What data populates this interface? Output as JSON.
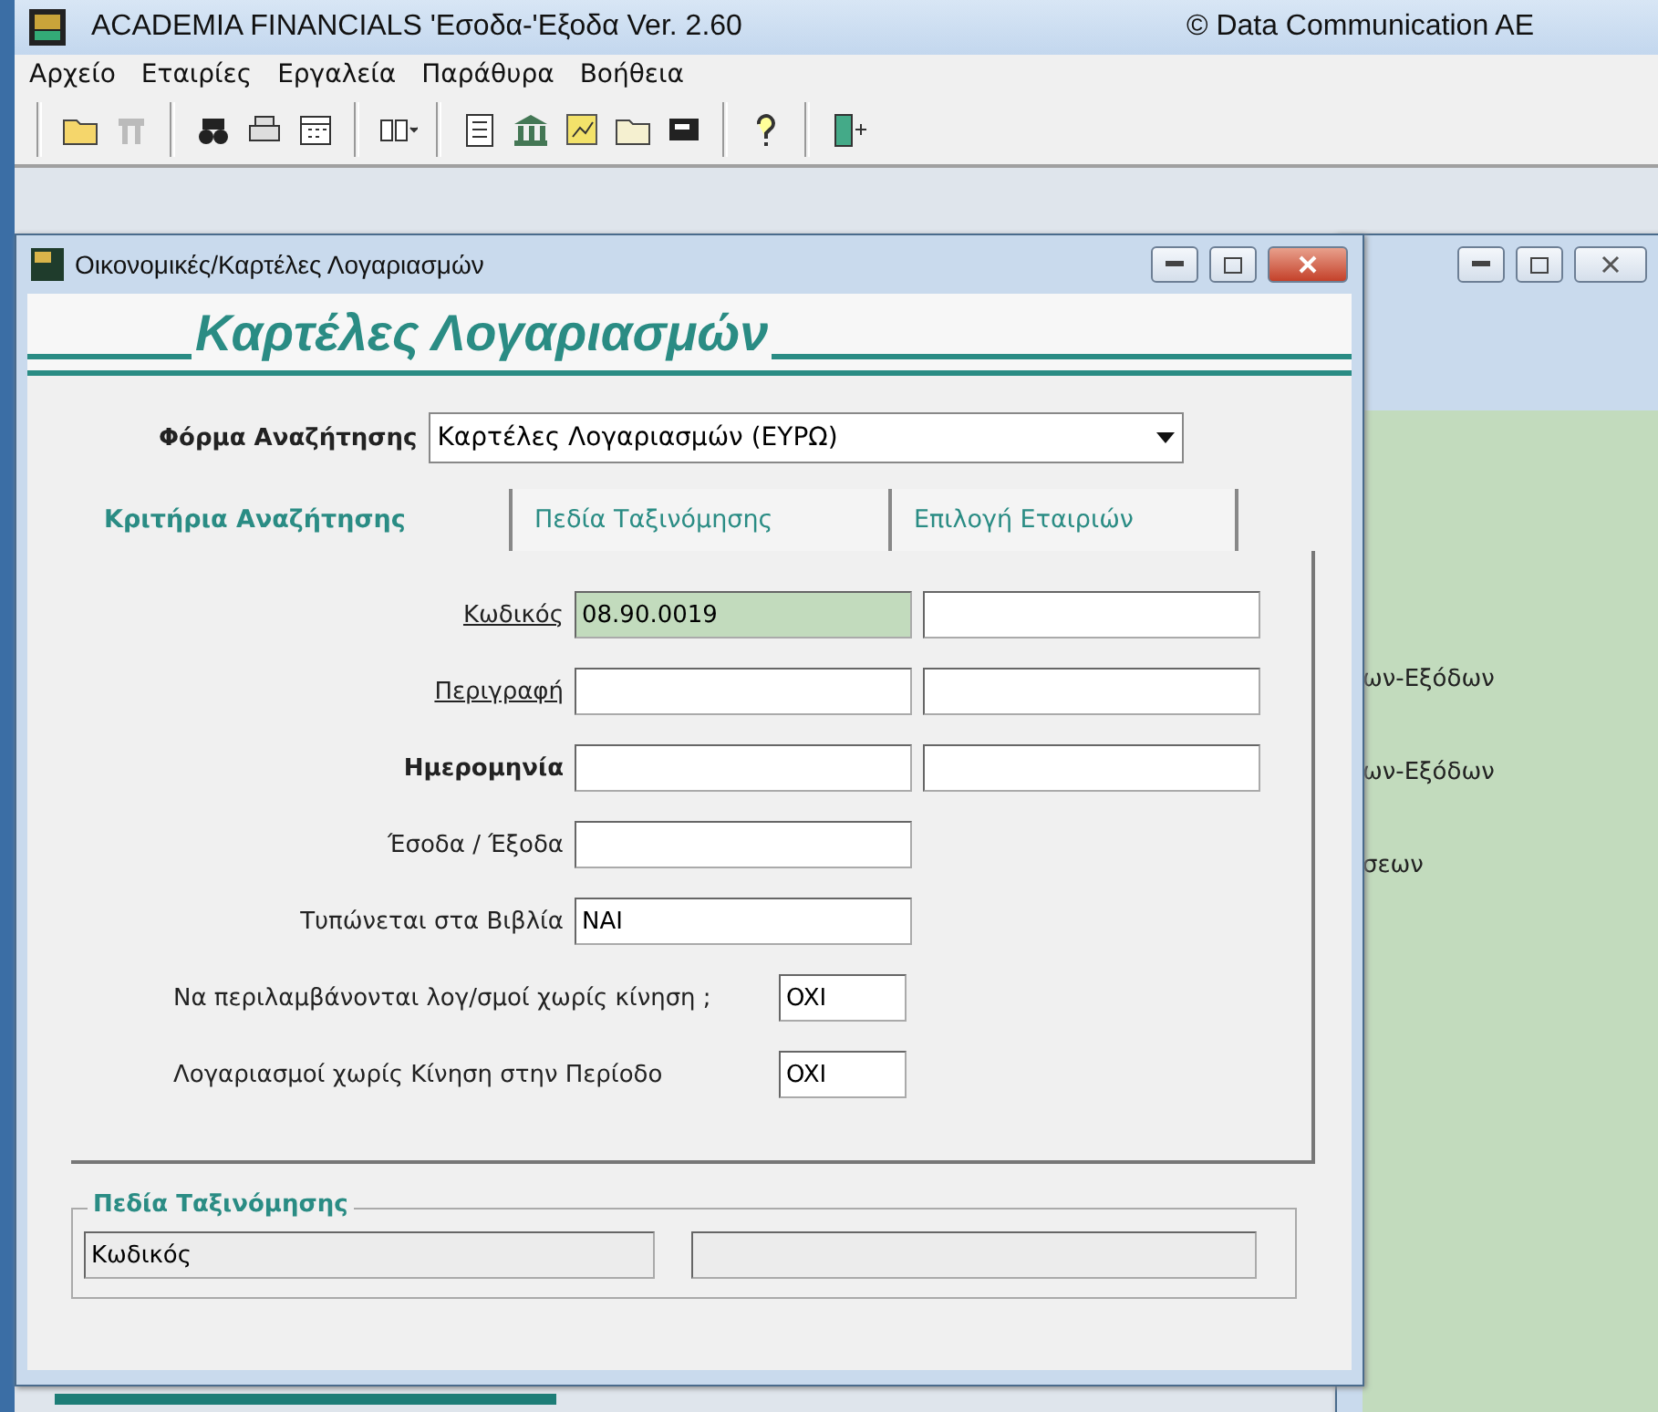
{
  "app": {
    "title": "ACADEMIA FINANCIALS 'Εσοδα-'Εξοδα Ver. 2.60",
    "copyright": "© Data Communication AE"
  },
  "menu": [
    "Αρχείο",
    "Εταιρίες",
    "Εργαλεία",
    "Παράθυρα",
    "Βοήθεια"
  ],
  "background_window": {
    "lines": [
      "ων-Εξόδων",
      "ων-Εξόδων",
      "σεων"
    ]
  },
  "dialog": {
    "title": "Οικονομικές/Καρτέλες Λογαριασμών",
    "heading": "Καρτέλες Λογαριασμών",
    "search_form": {
      "label": "Φόρμα Αναζήτησης",
      "value": "Καρτέλες Λογαριασμών (ΕΥΡΩ)"
    },
    "tabs": [
      {
        "label": "Κριτήρια Αναζήτησης",
        "selected": true
      },
      {
        "label": "Πεδία Ταξινόμησης",
        "selected": false
      },
      {
        "label": "Επιλογή Εταιριών",
        "selected": false
      }
    ],
    "fields": [
      {
        "label": "Κωδικός",
        "kind": "link",
        "value": "08.90.0019",
        "range": true,
        "highlighted": true
      },
      {
        "label": "Περιγραφή",
        "kind": "link",
        "range": true,
        "highlighted": false
      },
      {
        "label": "Ημερομηνία",
        "kind": "bold",
        "range": true,
        "highlighted": false
      },
      {
        "label": "Έσοδα / Έξοδα",
        "kind": "plain",
        "range": false,
        "highlighted": false
      },
      {
        "label": "Τυπώνεται στα Βιβλία",
        "kind": "plain",
        "value": "NAI",
        "range": false,
        "highlighted": false
      }
    ],
    "options": [
      {
        "label": "Να περιλαμβάνονται λογ/σμοί χωρίς κίνηση ;",
        "value": "OXI"
      },
      {
        "label": "Λογαριασμοί χωρίς Κίνηση στην Περίοδο",
        "value": "OXI"
      }
    ],
    "sort_group": {
      "title": "Πεδία Ταξινόμησης",
      "value": "Κωδικός"
    }
  }
}
